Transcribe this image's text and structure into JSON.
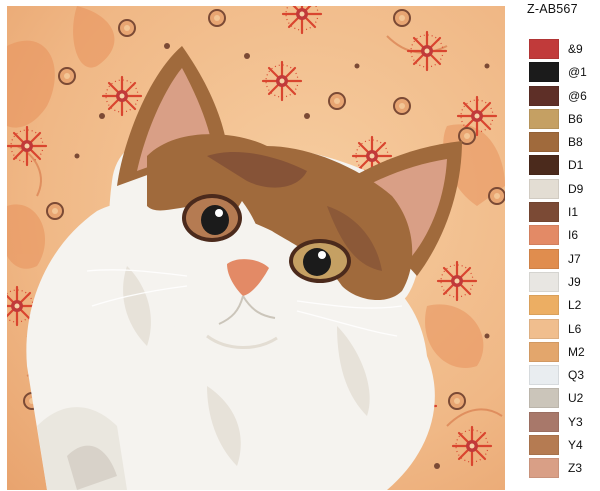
{
  "product_code": "Z-AB567",
  "artwork": {
    "subject_icon": "cat-portrait-painting",
    "background_color": "#f0b886",
    "accent_flower_color": "#d9452f"
  },
  "palette": [
    {
      "code": "&9",
      "color": "#c13a3a"
    },
    {
      "code": "@1",
      "color": "#1b1b1b"
    },
    {
      "code": "@6",
      "color": "#5e2f27"
    },
    {
      "code": "B6",
      "color": "#c5a063"
    },
    {
      "code": "B8",
      "color": "#a06a3c"
    },
    {
      "code": "D1",
      "color": "#4b2a1c"
    },
    {
      "code": "D9",
      "color": "#e3ddd3"
    },
    {
      "code": "I1",
      "color": "#7b4a35"
    },
    {
      "code": "I6",
      "color": "#e38a66"
    },
    {
      "code": "J7",
      "color": "#e08d4e"
    },
    {
      "code": "J9",
      "color": "#e8e6e2"
    },
    {
      "code": "L2",
      "color": "#ecae63"
    },
    {
      "code": "L6",
      "color": "#f0be8e"
    },
    {
      "code": "M2",
      "color": "#e3a66c"
    },
    {
      "code": "Q3",
      "color": "#e9edf0"
    },
    {
      "code": "U2",
      "color": "#cbc5ba"
    },
    {
      "code": "Y3",
      "color": "#a8786a"
    },
    {
      "code": "Y4",
      "color": "#b57b52"
    },
    {
      "code": "Z3",
      "color": "#d99f86"
    }
  ]
}
